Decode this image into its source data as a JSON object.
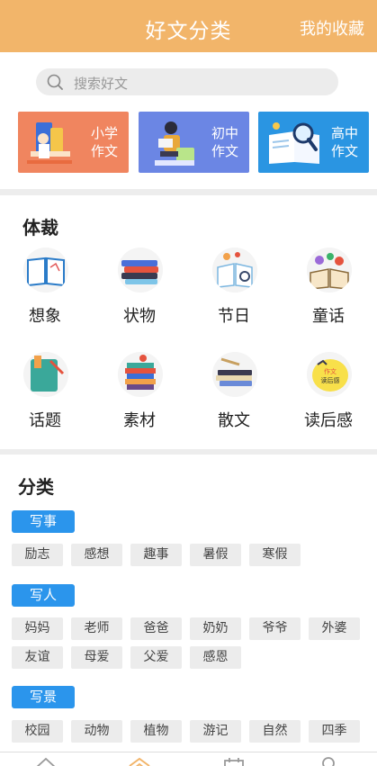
{
  "header": {
    "title": "好文分类",
    "favorites": "我的收藏"
  },
  "search": {
    "placeholder": "搜索好文",
    "icon": "search-icon"
  },
  "level_cards": [
    {
      "line1": "小学",
      "line2": "作文",
      "color": "#f0855f"
    },
    {
      "line1": "初中",
      "line2": "作文",
      "color": "#6b86e4"
    },
    {
      "line1": "高中",
      "line2": "作文",
      "color": "#2a95e2"
    }
  ],
  "genre": {
    "title": "体裁",
    "items": [
      {
        "label": "想象",
        "icon": "open-book-icon"
      },
      {
        "label": "状物",
        "icon": "book-stack-icon"
      },
      {
        "label": "节日",
        "icon": "book-magnifier-icon"
      },
      {
        "label": "童话",
        "icon": "fairy-book-icon"
      },
      {
        "label": "话题",
        "icon": "green-book-icon"
      },
      {
        "label": "素材",
        "icon": "tall-book-stack-icon"
      },
      {
        "label": "散文",
        "icon": "flat-book-stack-icon"
      },
      {
        "label": "读后感",
        "icon": "reading-note-icon"
      }
    ],
    "reading_note_badge_line1": "作文",
    "reading_note_badge_line2": "读后感"
  },
  "category": {
    "title": "分类",
    "groups": [
      {
        "label": "写事",
        "tags": [
          "励志",
          "感想",
          "趣事",
          "暑假",
          "寒假"
        ]
      },
      {
        "label": "写人",
        "tags": [
          "妈妈",
          "老师",
          "爸爸",
          "奶奶",
          "爷爷",
          "外婆",
          "友谊",
          "母爱",
          "父爱",
          "感恩"
        ]
      },
      {
        "label": "写景",
        "tags": [
          "校园",
          "动物",
          "植物",
          "游记",
          "自然",
          "四季"
        ]
      }
    ],
    "accent": "#2b95ec"
  },
  "tabbar": {
    "items": [
      {
        "icon": "home-icon"
      },
      {
        "icon": "category-icon",
        "active": true
      },
      {
        "icon": "calendar-icon"
      },
      {
        "icon": "profile-icon"
      }
    ]
  },
  "colors": {
    "header": "#f2b56a",
    "active_tab": "#f2b56a"
  }
}
